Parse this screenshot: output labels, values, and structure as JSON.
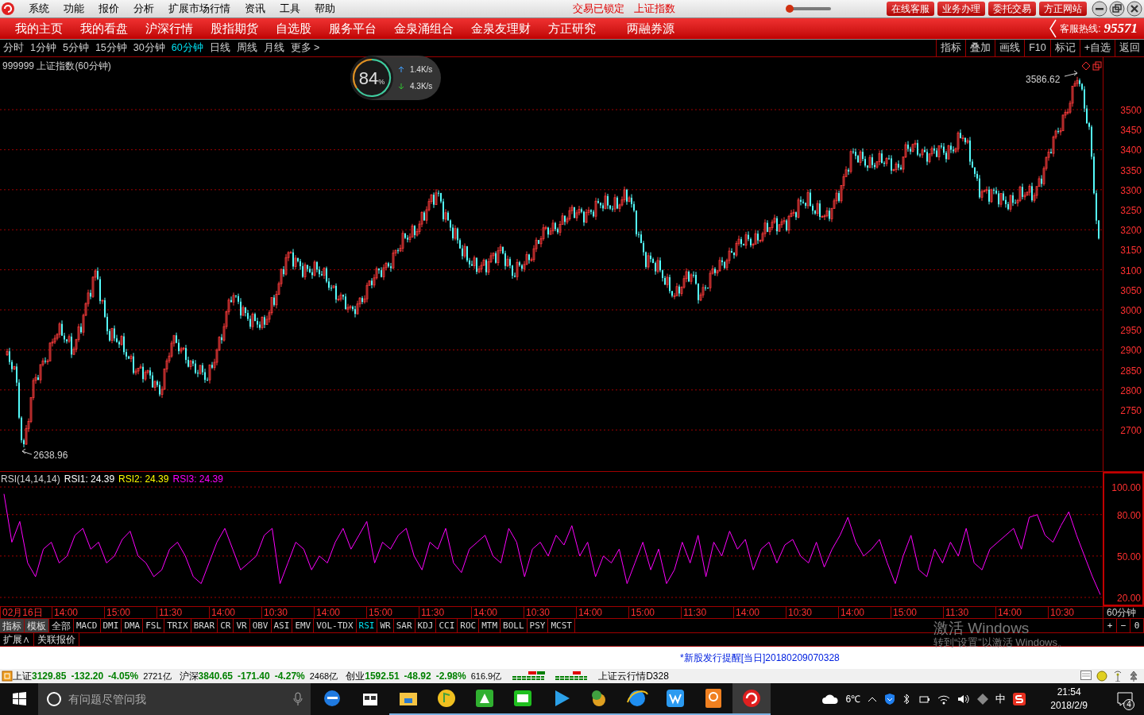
{
  "titlebar": {
    "menu": [
      "系统",
      "功能",
      "报价",
      "分析",
      "扩展市场行情",
      "资讯",
      "工具",
      "帮助"
    ],
    "status_texts": [
      "交易已锁定",
      "上证指数"
    ],
    "buttons": [
      "在线客服",
      "业务办理",
      "委托交易",
      "方正网站"
    ]
  },
  "nav": {
    "items": [
      "我的主页",
      "我的看盘",
      "沪深行情",
      "股指期货",
      "自选股",
      "服务平台",
      "金泉涌组合",
      "金泉友理财",
      "方正研究",
      "两融券源"
    ],
    "hotline_label": "客服热线:",
    "hotline_number": "95571"
  },
  "periods": [
    {
      "label": "分时",
      "selected": false
    },
    {
      "label": "1分钟",
      "selected": false
    },
    {
      "label": "5分钟",
      "selected": false
    },
    {
      "label": "15分钟",
      "selected": false
    },
    {
      "label": "30分钟",
      "selected": false
    },
    {
      "label": "60分钟",
      "selected": true
    },
    {
      "label": "日线",
      "selected": false
    },
    {
      "label": "周线",
      "selected": false
    },
    {
      "label": "月线",
      "selected": false
    },
    {
      "label": "更多 >",
      "selected": false
    }
  ],
  "toolbar": [
    "指标",
    "叠加",
    "画线",
    "F10",
    "标记",
    "+自选",
    "返回"
  ],
  "chart": {
    "title": "999999 上证指数(60分钟)",
    "high_label": "3586.62",
    "low_label": "2638.96",
    "price_ticks": [
      "3500",
      "3450",
      "3400",
      "3350",
      "3300",
      "3250",
      "3200",
      "3150",
      "3100",
      "3050",
      "3000",
      "2950",
      "2900",
      "2850",
      "2800",
      "2750",
      "2700"
    ]
  },
  "speed": {
    "percent": "84",
    "unit": "%",
    "up": "1.4K/s",
    "down": "4.3K/s"
  },
  "rsi": {
    "title": "RSI(14,14,14)",
    "lines": [
      {
        "label": "RSI1: 24.39",
        "color": "#ffffff"
      },
      {
        "label": "RSI2: 24.39",
        "color": "#ffff00"
      },
      {
        "label": "RSI3: 24.39",
        "color": "#ff00ff"
      }
    ],
    "chart_data": {
      "type": "line",
      "grid": true,
      "ylim": [
        20,
        100
      ],
      "yticks": [
        {
          "value": 100,
          "label": "100.00"
        },
        {
          "value": 80,
          "label": "80.00"
        },
        {
          "value": 50,
          "label": "50.00"
        },
        {
          "value": 20,
          "label": "20.00"
        }
      ],
      "series": [
        {
          "color": "#ff00ff",
          "values": [
            95,
            60,
            75,
            45,
            35,
            55,
            60,
            45,
            50,
            65,
            70,
            55,
            60,
            45,
            50,
            62,
            68,
            50,
            45,
            35,
            40,
            55,
            60,
            50,
            35,
            30,
            45,
            60,
            70,
            55,
            40,
            45,
            50,
            65,
            70,
            30,
            45,
            60,
            55,
            40,
            50,
            45,
            60,
            70,
            55,
            65,
            75,
            45,
            60,
            55,
            65,
            70,
            50,
            40,
            60,
            55,
            70,
            45,
            38,
            55,
            60,
            65,
            50,
            45,
            70,
            60,
            35,
            55,
            60,
            50,
            65,
            58,
            72,
            50,
            60,
            35,
            50,
            45,
            55,
            30,
            45,
            60,
            40,
            55,
            30,
            40,
            60,
            45,
            65,
            35,
            60,
            50,
            68,
            55,
            62,
            40,
            55,
            60,
            45,
            58,
            62,
            50,
            45,
            60,
            42,
            55,
            65,
            78,
            60,
            50,
            55,
            62,
            45,
            30,
            50,
            65,
            40,
            35,
            55,
            45,
            60,
            50,
            70,
            45,
            40,
            55,
            60,
            65,
            70,
            55,
            78,
            80,
            65,
            60,
            72,
            82,
            65,
            50,
            35,
            22
          ]
        }
      ]
    }
  },
  "time_axis": {
    "labels": [
      "02月16日",
      "14:00",
      "15:00",
      "11:30",
      "14:00",
      "10:30",
      "14:00",
      "15:00",
      "11:30",
      "14:00",
      "10:30",
      "14:00",
      "15:00",
      "11:30",
      "14:00",
      "10:30",
      "14:00",
      "15:00",
      "11:30",
      "14:00",
      "10:30"
    ],
    "period": "60分钟"
  },
  "mode_buttons": [
    "指标",
    "模板"
  ],
  "indicator_tabs": [
    {
      "label": "全部",
      "selected": false
    },
    {
      "label": "MACD",
      "selected": false
    },
    {
      "label": "DMI",
      "selected": false
    },
    {
      "label": "DMA",
      "selected": false
    },
    {
      "label": "FSL",
      "selected": false
    },
    {
      "label": "TRIX",
      "selected": false
    },
    {
      "label": "BRAR",
      "selected": false
    },
    {
      "label": "CR",
      "selected": false
    },
    {
      "label": "VR",
      "selected": false
    },
    {
      "label": "OBV",
      "selected": false
    },
    {
      "label": "ASI",
      "selected": false
    },
    {
      "label": "EMV",
      "selected": false
    },
    {
      "label": "VOL-TDX",
      "selected": false
    },
    {
      "label": "RSI",
      "selected": true
    },
    {
      "label": "WR",
      "selected": false
    },
    {
      "label": "SAR",
      "selected": false
    },
    {
      "label": "KDJ",
      "selected": false
    },
    {
      "label": "CCI",
      "selected": false
    },
    {
      "label": "ROC",
      "selected": false
    },
    {
      "label": "MTM",
      "selected": false
    },
    {
      "label": "BOLL",
      "selected": false
    },
    {
      "label": "PSY",
      "selected": false
    },
    {
      "label": "MCST",
      "selected": false
    }
  ],
  "zoom_buttons": [
    "+",
    "−",
    "0"
  ],
  "extra_tabs": [
    "扩展∧",
    "关联报价"
  ],
  "activation": {
    "title": "激活 Windows",
    "subtitle": "转到“设置”以激活 Windows。"
  },
  "notice": "*新股发行提醒[当日]20180209070328",
  "status_bar": {
    "markets": [
      {
        "name": "上证",
        "value": "3129.85",
        "change": "-132.20",
        "percent": "-4.05%",
        "volume": "2721亿"
      },
      {
        "name": "沪深",
        "value": "3840.65",
        "change": "-171.40",
        "percent": "-4.27%",
        "volume": "2468亿"
      },
      {
        "name": "创业",
        "value": "1592.51",
        "change": "-48.92",
        "percent": "-2.98%",
        "volume": "616.9亿"
      }
    ],
    "ticker": "上证云行情D328"
  },
  "taskbar": {
    "search_placeholder": "有问题尽管问我",
    "weather": "6℃",
    "ime": "中",
    "time": "21:54",
    "date": "2018/2/9",
    "notifications": "4"
  }
}
